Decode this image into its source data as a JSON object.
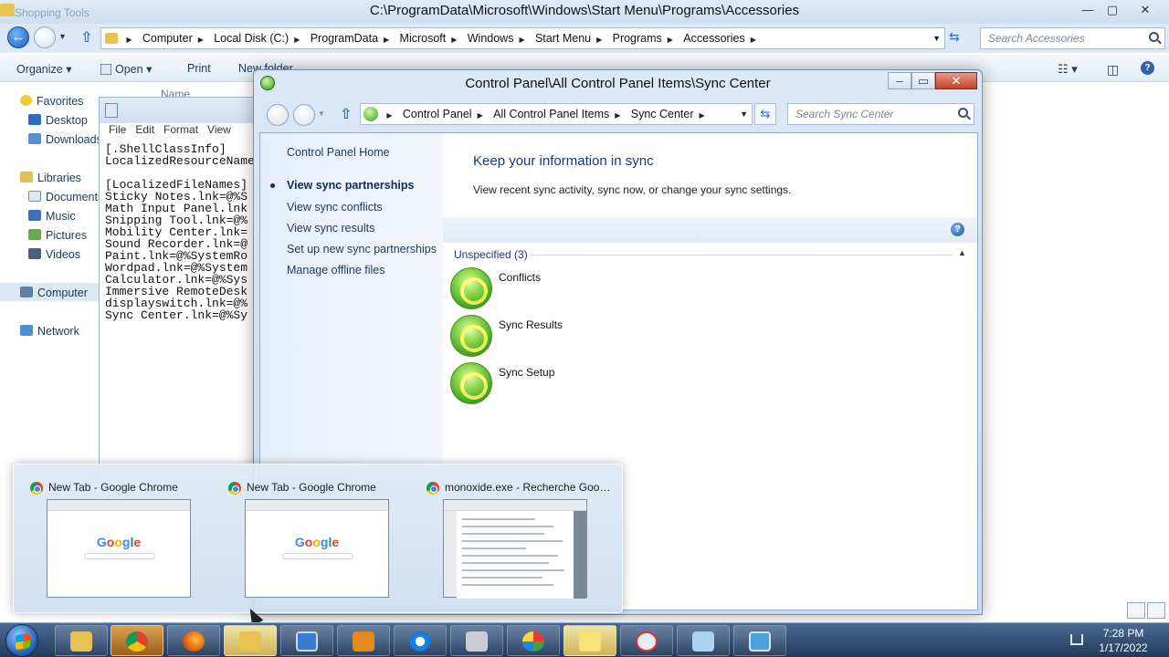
{
  "explorer": {
    "ghost_title": "Shopping Tools",
    "title": "C:\\ProgramData\\Microsoft\\Windows\\Start Menu\\Programs\\Accessories",
    "breadcrumbs": [
      "Computer",
      "Local Disk (C:)",
      "ProgramData",
      "Microsoft",
      "Windows",
      "Start Menu",
      "Programs",
      "Accessories"
    ],
    "search_placeholder": "Search Accessories",
    "toolbar": {
      "organize": "Organize",
      "open": "Open",
      "print": "Print",
      "new_folder": "New folder"
    },
    "column_name": "Name",
    "nav": {
      "favorites": "Favorites",
      "desktop": "Desktop",
      "downloads": "Downloads",
      "libraries": "Libraries",
      "documents": "Documents",
      "music": "Music",
      "pictures": "Pictures",
      "videos": "Videos",
      "computer": "Computer",
      "network": "Network"
    }
  },
  "notepad": {
    "menu": [
      "File",
      "Edit",
      "Format",
      "View"
    ],
    "lines": [
      "[.ShellClassInfo]",
      "LocalizedResourceName",
      "",
      "[LocalizedFileNames]",
      "Sticky Notes.lnk=@%S",
      "Math Input Panel.lnk",
      "Snipping Tool.lnk=@%",
      "Mobility Center.lnk=",
      "Sound Recorder.lnk=@",
      "Paint.lnk=@%SystemRo",
      "Wordpad.lnk=@%System",
      "Calculator.lnk=@%Sys",
      "Immersive RemoteDesk",
      "displayswitch.lnk=@%",
      "Sync Center.lnk=@%Sy"
    ]
  },
  "sync": {
    "title": "Control Panel\\All Control Panel Items\\Sync Center",
    "breadcrumbs": [
      "Control Panel",
      "All Control Panel Items",
      "Sync Center"
    ],
    "search_placeholder": "Search Sync Center",
    "left": {
      "home": "Control Panel Home",
      "links": [
        "View sync partnerships",
        "View sync conflicts",
        "View sync results",
        "Set up new sync partnerships",
        "Manage offline files"
      ]
    },
    "heading": "Keep your information in sync",
    "subheading": "View recent sync activity, sync now, or change your sync settings.",
    "group": "Unspecified (3)",
    "items": [
      "Conflicts",
      "Sync Results",
      "Sync Setup"
    ]
  },
  "thumbnails": [
    {
      "title": "New Tab - Google Chrome",
      "logo": "Google"
    },
    {
      "title": "New Tab - Google Chrome",
      "logo": "Google"
    },
    {
      "title": "monoxide.exe - Recherche Google - Google Chrome"
    }
  ],
  "taskbar": {
    "time": "7:28 PM",
    "date": "1/17/2022",
    "apps": [
      "file-explorer",
      "chrome",
      "firefox",
      "folder",
      "remote-desktop",
      "media-player",
      "internet-explorer",
      "fax-scan",
      "paint",
      "sticky-notes",
      "snipping-tool",
      "notepad",
      "sync-center"
    ]
  }
}
